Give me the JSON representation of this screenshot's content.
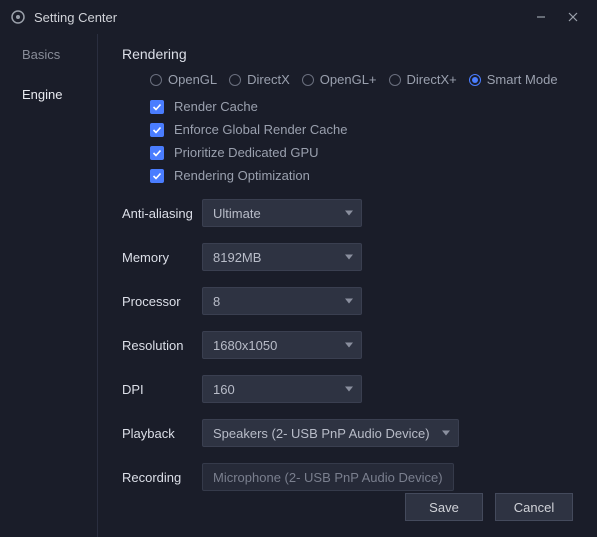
{
  "window": {
    "title": "Setting Center"
  },
  "sidebar": {
    "items": [
      {
        "label": "Basics"
      },
      {
        "label": "Engine"
      }
    ]
  },
  "section": {
    "title": "Rendering"
  },
  "renderers": {
    "opengl": "OpenGL",
    "directx": "DirectX",
    "opengl_plus": "OpenGL+",
    "directx_plus": "DirectX+",
    "smart": "Smart Mode"
  },
  "checks": {
    "render_cache": "Render Cache",
    "enforce_global": "Enforce Global Render Cache",
    "prioritize_gpu": "Prioritize Dedicated GPU",
    "rendering_opt": "Rendering Optimization"
  },
  "labels": {
    "anti_aliasing": "Anti-aliasing",
    "memory": "Memory",
    "processor": "Processor",
    "resolution": "Resolution",
    "dpi": "DPI",
    "playback": "Playback",
    "recording": "Recording"
  },
  "values": {
    "anti_aliasing": "Ultimate",
    "memory": "8192MB",
    "processor": "8",
    "resolution": "1680x1050",
    "dpi": "160",
    "playback": "Speakers (2- USB PnP Audio Device)",
    "recording": "Microphone (2- USB PnP Audio Device)"
  },
  "footer": {
    "save": "Save",
    "cancel": "Cancel"
  }
}
